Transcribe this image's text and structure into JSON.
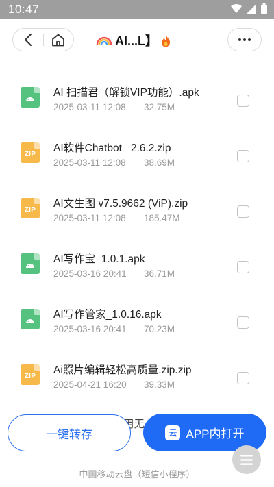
{
  "status_bar": {
    "time": "10:47"
  },
  "header": {
    "title": "AI...L】"
  },
  "files": [
    {
      "type": "apk",
      "name": "AI 扫描君（解锁VIP功能）.apk",
      "date": "2025-03-11 12:08",
      "size": "32.75M"
    },
    {
      "type": "zip",
      "name": "AI软件Chatbot _2.6.2.zip",
      "date": "2025-03-11 12:08",
      "size": "38.69M"
    },
    {
      "type": "zip",
      "name": "AI文生图 v7.5.9662 (ViP).zip",
      "date": "2025-03-11 12:08",
      "size": "185.47M"
    },
    {
      "type": "apk",
      "name": "AI写作宝_1.0.1.apk",
      "date": "2025-03-16 20:41",
      "size": "36.71M"
    },
    {
      "type": "apk",
      "name": "AI写作管家_1.0.16.apk",
      "date": "2025-03-16 20:41",
      "size": "70.23M"
    },
    {
      "type": "zip",
      "name": "Ai照片编辑轻松高质量.zip.zip",
      "date": "2025-04-21 16:20",
      "size": "39.33M"
    }
  ],
  "zip_badge": "ZIP",
  "partial_text": "用无",
  "bottom": {
    "save_label": "一键转存",
    "open_label": "APP内打开",
    "cloud_glyph": "云",
    "footer": "中国移动云盘（短信小程序）"
  },
  "colors": {
    "primary": "#1f6bf5",
    "apk": "#56c27f",
    "zip": "#f8b94b"
  }
}
